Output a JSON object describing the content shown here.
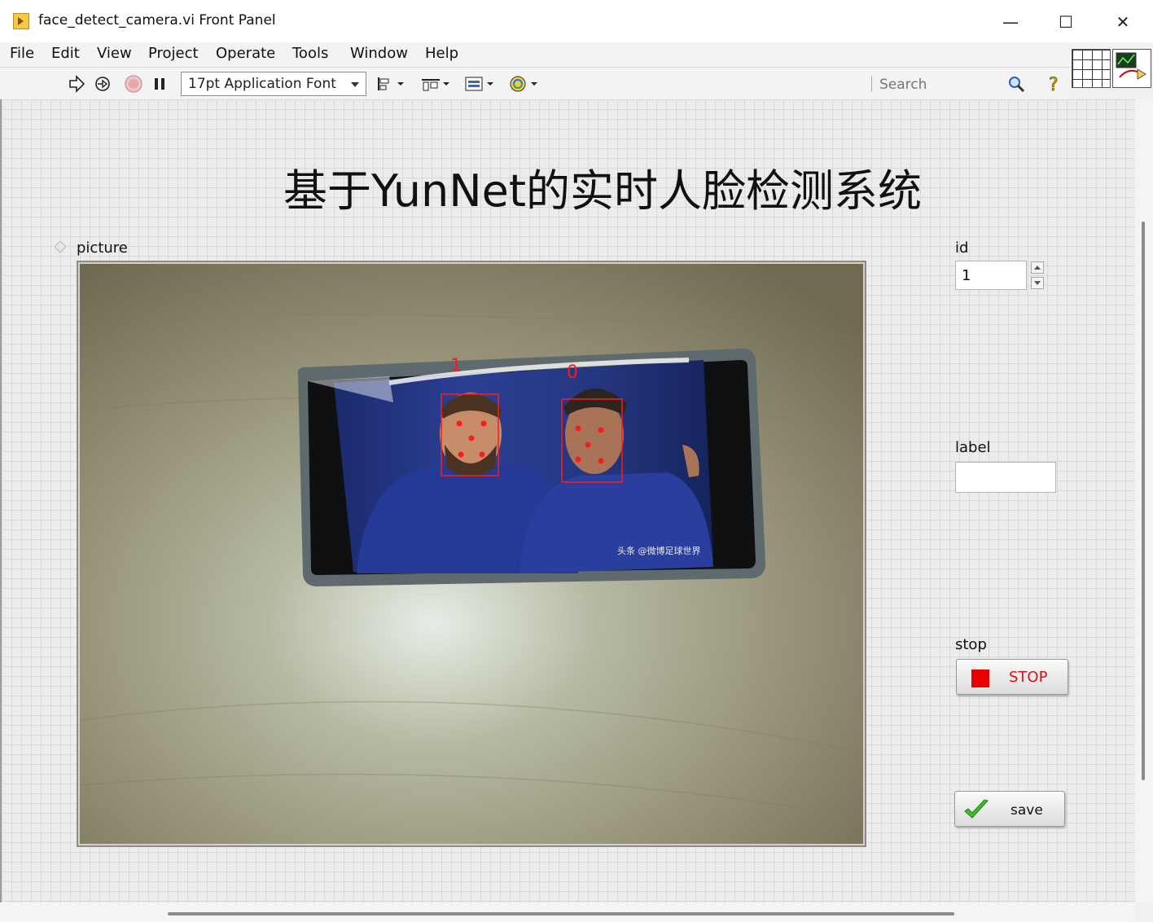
{
  "window": {
    "title": "face_detect_camera.vi Front Panel",
    "controls": {
      "minimize": "—",
      "maximize": "☐",
      "close": "✕"
    }
  },
  "menu": [
    "File",
    "Edit",
    "View",
    "Project",
    "Operate",
    "Tools",
    "Window",
    "Help"
  ],
  "toolbar": {
    "font_selector": "17pt Application Font",
    "search_placeholder": "Search",
    "icons": [
      "run-arrow-icon",
      "run-continuously-icon",
      "abort-icon",
      "pause-icon",
      "align-objects-icon",
      "distribute-objects-icon",
      "resize-objects-icon",
      "reorder-icon",
      "search-icon",
      "context-help-icon"
    ]
  },
  "panel": {
    "heading": "基于YunNet的实时人脸检测系统",
    "picture": {
      "label": "picture",
      "faces": [
        {
          "id_label": "1"
        },
        {
          "id_label": "0"
        }
      ],
      "watermark": "头条 @微博足球世界"
    },
    "id": {
      "label": "id",
      "value": "1"
    },
    "label_field": {
      "label": "label",
      "value": ""
    },
    "stop": {
      "label": "stop",
      "button_text": "STOP"
    },
    "save": {
      "button_text": "save"
    }
  },
  "colors": {
    "panel_grid": "#d8d8d8",
    "stop_red": "#e60000",
    "detection_box": "#ff1a1a",
    "save_check": "#3fbf2a"
  }
}
